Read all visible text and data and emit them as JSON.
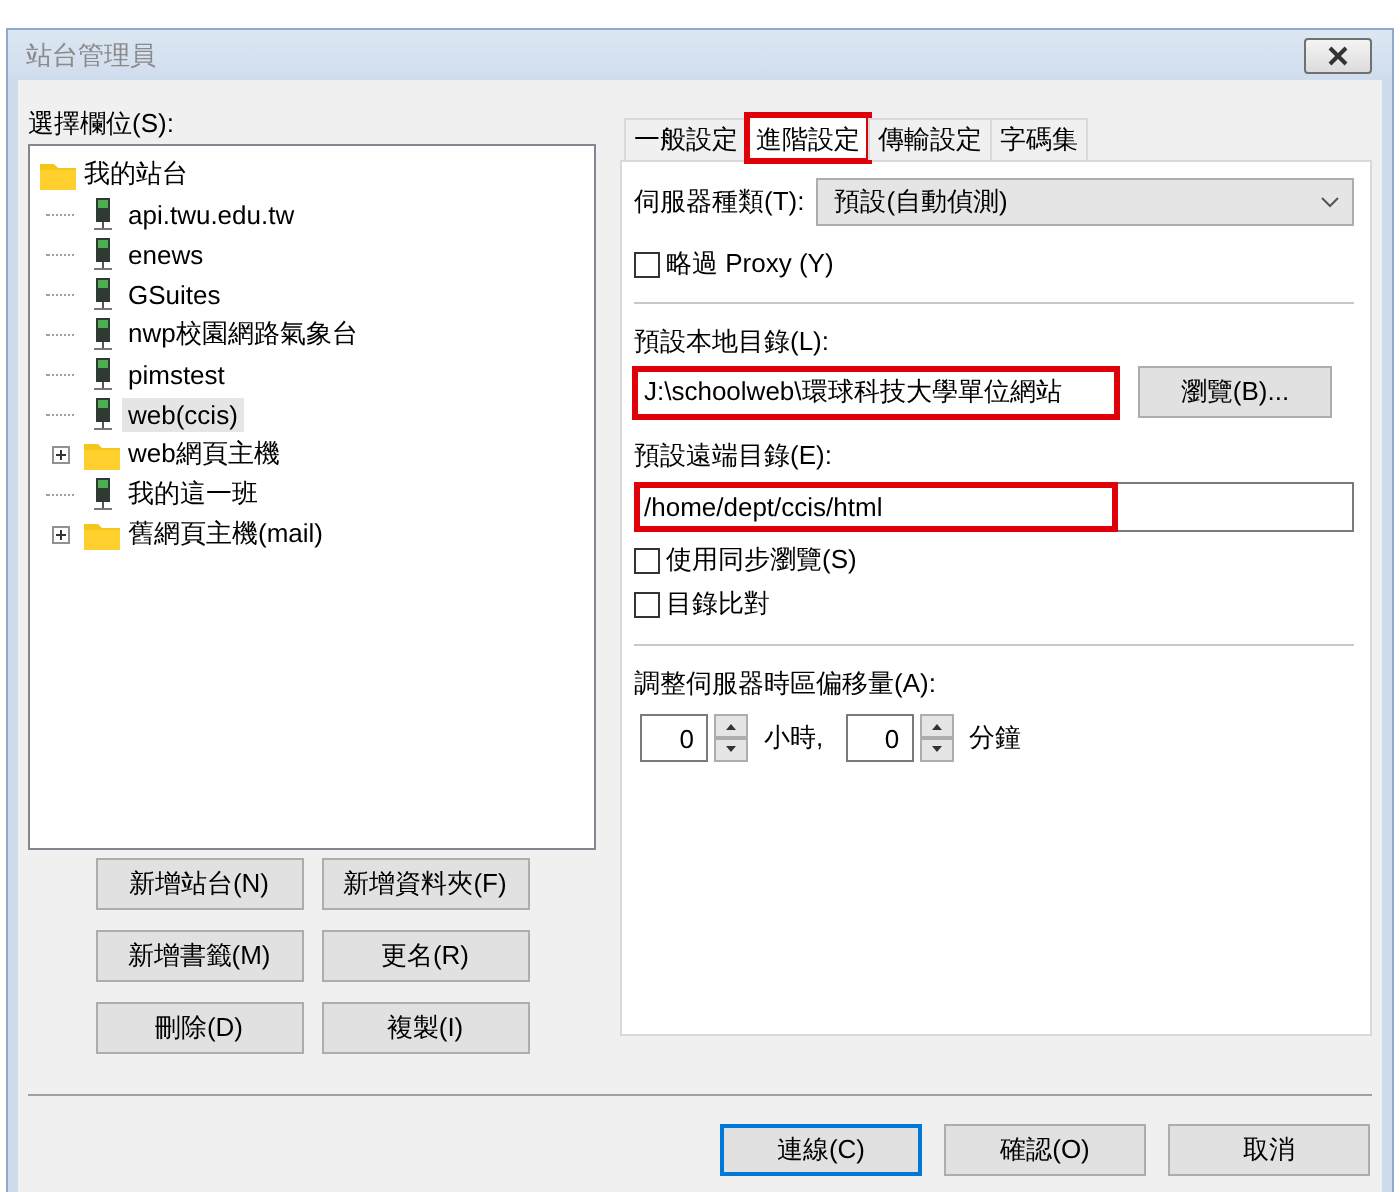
{
  "window": {
    "title": "站台管理員"
  },
  "site_list": {
    "label": "選擇欄位(S):",
    "tree": [
      {
        "label": "我的站台",
        "kind": "folder",
        "selected": false,
        "children": [
          {
            "label": "api.twu.edu.tw",
            "kind": "server",
            "selected": false
          },
          {
            "label": "enews",
            "kind": "server",
            "selected": false
          },
          {
            "label": "GSuites",
            "kind": "server",
            "selected": false
          },
          {
            "label": "nwp校園網路氣象台",
            "kind": "server",
            "selected": false
          },
          {
            "label": "pimstest",
            "kind": "server",
            "selected": false
          },
          {
            "label": "web(ccis)",
            "kind": "server",
            "selected": true
          },
          {
            "label": "web網頁主機",
            "kind": "folder",
            "expanded": false,
            "selected": false
          },
          {
            "label": "我的這一班",
            "kind": "server",
            "selected": false
          },
          {
            "label": "舊網頁主機(mail)",
            "kind": "folder",
            "expanded": false,
            "selected": false
          }
        ]
      }
    ]
  },
  "site_buttons": [
    "新增站台(N)",
    "新增資料夾(F)",
    "新增書籤(M)",
    "更名(R)",
    "刪除(D)",
    "複製(I)"
  ],
  "tabs": [
    {
      "label": "一般設定",
      "selected": false,
      "highlighted": false
    },
    {
      "label": "進階設定",
      "selected": true,
      "highlighted": true
    },
    {
      "label": "傳輸設定",
      "selected": false,
      "highlighted": false
    },
    {
      "label": "字碼集",
      "selected": false,
      "highlighted": false
    }
  ],
  "server_type": {
    "label": "伺服器種類(T):",
    "value": "預設(自動偵測)"
  },
  "bypass_proxy": {
    "label": "略過 Proxy (Y)",
    "checked": false
  },
  "local_dir": {
    "label": "預設本地目錄(L):",
    "value": "J:\\schoolweb\\環球科技大學單位網站",
    "highlighted": true,
    "browse_button": "瀏覽(B)..."
  },
  "remote_dir": {
    "label": "預設遠端目錄(E):",
    "value": "/home/dept/ccis/html",
    "highlighted": true
  },
  "sync_browse": {
    "label": "使用同步瀏覽(S)",
    "checked": false
  },
  "dir_compare": {
    "label": "目錄比對",
    "checked": false
  },
  "time_offset": {
    "label": "調整伺服器時區偏移量(A):",
    "hours": "0",
    "hours_unit": "小時,",
    "minutes": "0",
    "minutes_unit": "分鐘"
  },
  "dialog_buttons": [
    {
      "label": "連線(C)",
      "default": true
    },
    {
      "label": "確認(O)",
      "default": false
    },
    {
      "label": "取消",
      "default": false
    }
  ]
}
